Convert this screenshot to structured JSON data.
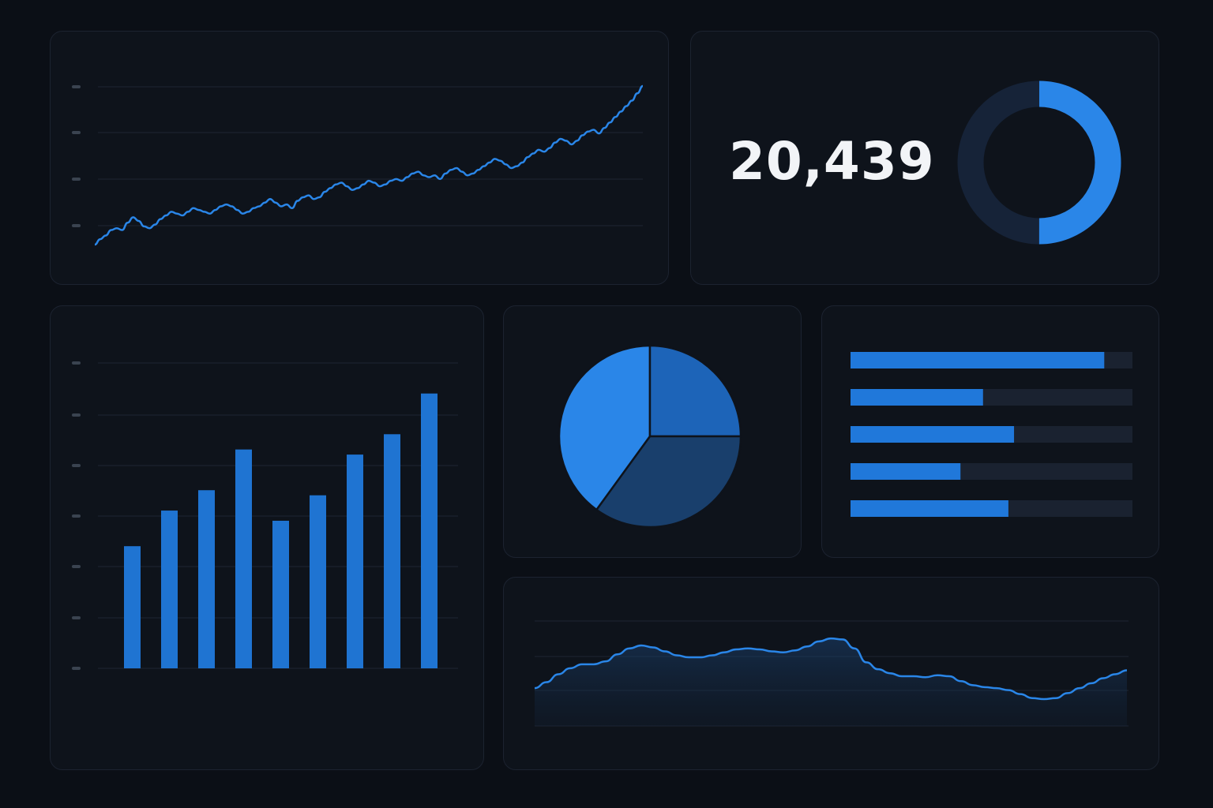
{
  "colors": {
    "accent": "#2a86e8",
    "accent_dark": "#1a4f86",
    "accent_mid": "#1d6cc6",
    "track": "#1a2230",
    "grid": "#1e2633",
    "tick": "#3a4350",
    "text": "#f2f4f7"
  },
  "kpi": {
    "value": "20,439"
  },
  "chart_data": [
    {
      "type": "line",
      "title": "",
      "grid": true,
      "ylim": [
        0,
        100
      ],
      "x": [
        0,
        1,
        2,
        3,
        4,
        5,
        6,
        7,
        8,
        9,
        10,
        11,
        12,
        13,
        14,
        15,
        16,
        17,
        18,
        19,
        20,
        21,
        22,
        23,
        24,
        25,
        26,
        27,
        28,
        29,
        30,
        31,
        32,
        33,
        34,
        35,
        36,
        37,
        38,
        39,
        40,
        41,
        42,
        43,
        44,
        45,
        46,
        47,
        48,
        49,
        50,
        51,
        52,
        53,
        54,
        55,
        56,
        57,
        58,
        59,
        60,
        61,
        62,
        63,
        64,
        65,
        66,
        67,
        68,
        69,
        70,
        71,
        72,
        73,
        74,
        75,
        76,
        77,
        78,
        79,
        80,
        81,
        82,
        83,
        84,
        85,
        86,
        87,
        88,
        89,
        90,
        91,
        92,
        93,
        94,
        95,
        96,
        97,
        98,
        99,
        100
      ],
      "y": [
        0,
        3,
        5,
        8,
        9,
        8,
        12,
        15,
        13,
        10,
        9,
        11,
        14,
        16,
        18,
        17,
        16,
        18,
        20,
        19,
        18,
        17,
        19,
        21,
        22,
        21,
        19,
        17,
        18,
        20,
        21,
        23,
        25,
        23,
        21,
        22,
        20,
        24,
        26,
        27,
        25,
        26,
        29,
        31,
        33,
        34,
        32,
        30,
        31,
        33,
        35,
        34,
        32,
        33,
        35,
        36,
        35,
        37,
        39,
        40,
        38,
        37,
        38,
        36,
        39,
        41,
        42,
        40,
        38,
        39,
        41,
        43,
        45,
        47,
        46,
        44,
        42,
        43,
        45,
        48,
        50,
        52,
        51,
        53,
        56,
        58,
        57,
        55,
        57,
        60,
        62,
        63,
        61,
        64,
        67,
        70,
        73,
        76,
        79,
        83,
        87
      ]
    },
    {
      "type": "donut",
      "values": [
        50,
        50
      ]
    },
    {
      "type": "bar",
      "grid": true,
      "ylim": [
        0,
        6
      ],
      "categories": [
        "",
        "",
        "",
        "",
        "",
        "",
        "",
        "",
        ""
      ],
      "values": [
        2.4,
        3.1,
        3.5,
        4.3,
        2.9,
        3.4,
        4.2,
        4.6,
        5.4
      ]
    },
    {
      "type": "pie",
      "values": [
        40,
        25,
        35
      ]
    },
    {
      "type": "bar",
      "orientation": "horizontal",
      "xlim": [
        0,
        100
      ],
      "categories": [
        "",
        "",
        "",
        "",
        ""
      ],
      "values": [
        90,
        47,
        58,
        39,
        56
      ]
    },
    {
      "type": "area",
      "grid": true,
      "ylim": [
        0,
        100
      ],
      "x": [
        0,
        1,
        2,
        3,
        4,
        5,
        6,
        7,
        8,
        9,
        10,
        11,
        12,
        13,
        14,
        15,
        16,
        17,
        18,
        19,
        20,
        21,
        22,
        23,
        24,
        25,
        26,
        27,
        28,
        29,
        30,
        31,
        32,
        33,
        34,
        35,
        36,
        37,
        38,
        39,
        40,
        41,
        42,
        43,
        44,
        45,
        46,
        47,
        48,
        49,
        50
      ],
      "y": [
        38,
        44,
        52,
        58,
        62,
        62,
        65,
        72,
        78,
        81,
        79,
        75,
        71,
        69,
        69,
        71,
        74,
        77,
        78,
        77,
        75,
        74,
        76,
        80,
        85,
        88,
        87,
        78,
        64,
        57,
        53,
        50,
        50,
        49,
        51,
        50,
        45,
        41,
        39,
        38,
        36,
        32,
        28,
        27,
        28,
        33,
        38,
        43,
        48,
        52,
        56
      ]
    }
  ]
}
